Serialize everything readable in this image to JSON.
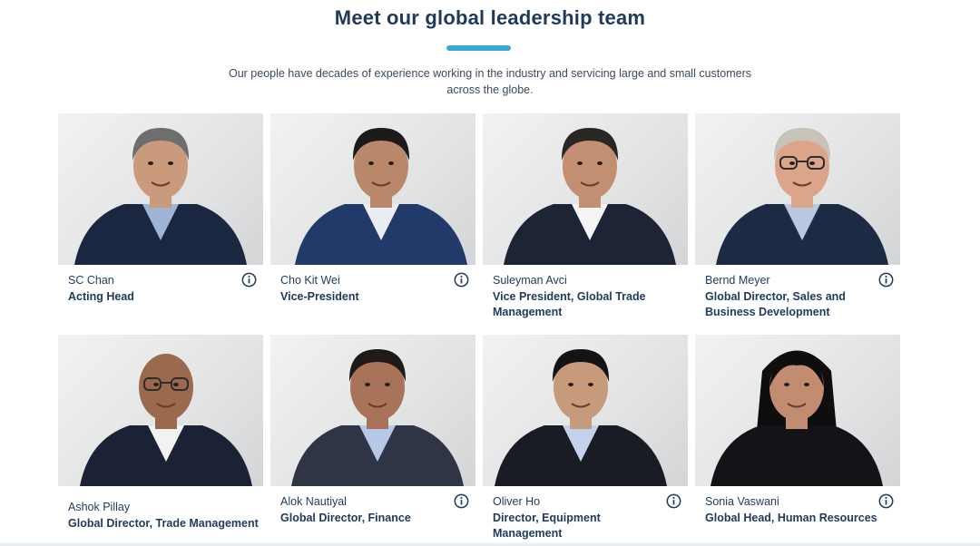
{
  "header": {
    "title": "Meet our global leadership team",
    "subtitle": "Our people have decades of experience working in the industry and servicing large and small customers across the globe."
  },
  "colors": {
    "heading": "#1f3a5a",
    "accent": "#3ba6d4"
  },
  "team": [
    {
      "name": "SC Chan",
      "role": "Acting Head",
      "info_icon": "info-circle-icon"
    },
    {
      "name": "Cho Kit Wei",
      "role": "Vice-President",
      "info_icon": "info-circle-icon"
    },
    {
      "name": "Suleyman Avci",
      "role": "Vice President, Global Trade Management",
      "info_icon": "info-circle-icon"
    },
    {
      "name": "Bernd Meyer",
      "role": "Global Director, Sales and Business Development",
      "info_icon": "info-circle-icon"
    },
    {
      "name": "Ashok Pillay",
      "role": "Global Director, Trade Management",
      "info_icon": ""
    },
    {
      "name": "Alok Nautiyal",
      "role": "Global Director, Finance",
      "info_icon": "info-circle-icon"
    },
    {
      "name": "Oliver Ho",
      "role": "Director, Equipment Management",
      "info_icon": "info-circle-icon"
    },
    {
      "name": "Sonia Vaswani",
      "role": "Global Head, Human Resources",
      "info_icon": "info-circle-icon"
    }
  ]
}
